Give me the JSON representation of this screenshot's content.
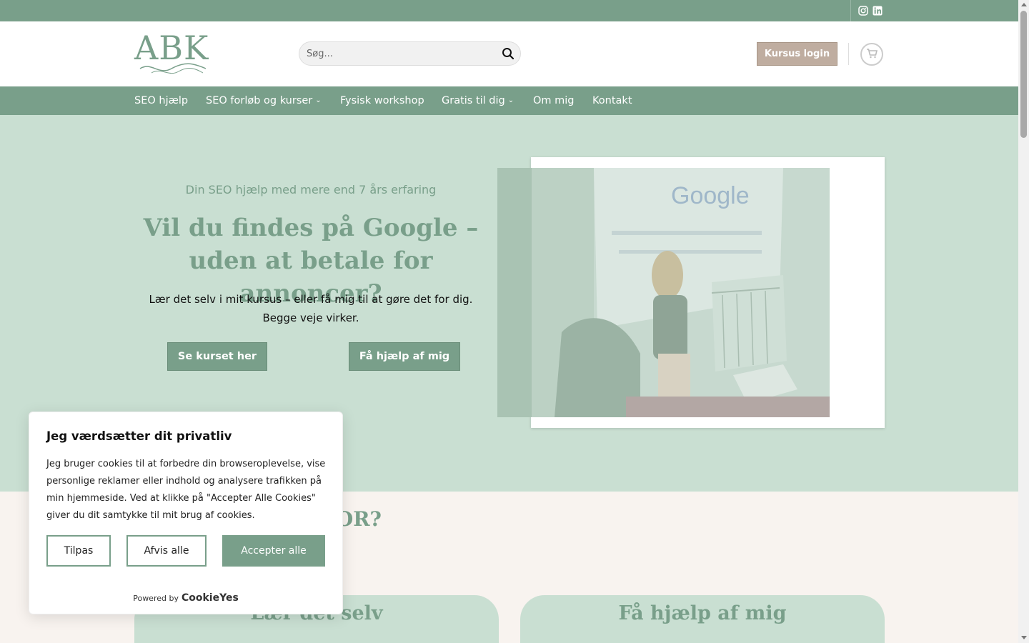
{
  "colors": {
    "brand": "#799f8a",
    "hero_bg": "#c9dfd2",
    "login_btn": "#bfada0",
    "page_bg": "#f8f3ef"
  },
  "topbar": {
    "icons": [
      "instagram-icon",
      "linkedin-icon"
    ]
  },
  "header": {
    "logo_text": "ABK",
    "search_placeholder": "Søg...",
    "login_label": "Kursus login",
    "cart_icon": "cart-icon"
  },
  "nav": {
    "items": [
      {
        "label": "SEO hjælp",
        "has_dropdown": false
      },
      {
        "label": "SEO forløb og kurser",
        "has_dropdown": true
      },
      {
        "label": "Fysisk workshop",
        "has_dropdown": false
      },
      {
        "label": "Gratis til dig",
        "has_dropdown": true
      },
      {
        "label": "Om mig",
        "has_dropdown": false
      },
      {
        "label": "Kontakt",
        "has_dropdown": false
      }
    ]
  },
  "hero": {
    "subtitle": "Din SEO hjælp med mere end 7 års erfaring",
    "title": "Vil du findes på Google – uden at betale for annoncer?",
    "text": "Lær det selv i mit kursus – eller få mig til at gøre det for dig. Begge veje virker.",
    "btn_course": "Se kurset her",
    "btn_help": "Få hjælp af mig",
    "photo_screen_text": "Google"
  },
  "section2": {
    "heading_visible": "FOR?",
    "card_left": "Lær det selv",
    "card_right": "Få hjælp af mig"
  },
  "cookie": {
    "title": "Jeg værdsætter dit privatliv",
    "body": "Jeg bruger cookies til at forbedre din browseroplevelse, vise personlige reklamer eller indhold og analysere trafikken på min hjemmeside. Ved at klikke på \"Accepter Alle Cookies\" giver du dit samtykke til mit brug af cookies.",
    "btn_customize": "Tilpas",
    "btn_reject": "Afvis alle",
    "btn_accept": "Accepter alle",
    "powered_by": "Powered by",
    "powered_brand": "CookieYes"
  }
}
